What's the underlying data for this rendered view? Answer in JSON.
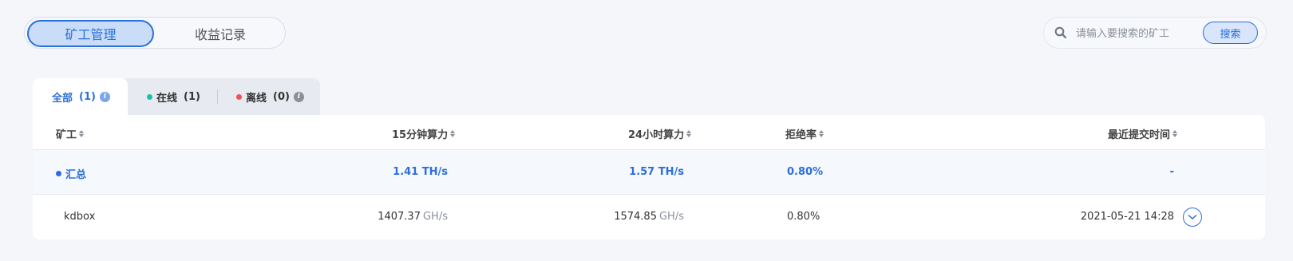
{
  "top_tabs": {
    "active": "矿工管理",
    "inactive": "收益记录"
  },
  "search": {
    "placeholder": "请输入要搜索的矿工",
    "button": "搜索"
  },
  "status_tabs": {
    "all": {
      "label": "全部",
      "count": "(1)"
    },
    "online": {
      "label": "在线",
      "count": "(1)",
      "dot_color": "#1dbfb0"
    },
    "offline": {
      "label": "离线",
      "count": "(0)",
      "dot_color": "#f0505b"
    }
  },
  "table": {
    "headers": [
      "矿工",
      "15分钟算力",
      "24小时算力",
      "拒绝率",
      "最近提交时间"
    ],
    "summary": {
      "name": "汇总",
      "h15": "1.41 TH/s",
      "h24": "1.57 TH/s",
      "reject": "0.80%",
      "last": "-",
      "dot_color": "#2c6fd8"
    },
    "rows": [
      {
        "name": "kdbox",
        "h15": "1407.37",
        "h15_unit": "GH/s",
        "h24": "1574.85",
        "h24_unit": "GH/s",
        "reject": "0.80%",
        "last": "2021-05-21 14:28"
      }
    ]
  },
  "colors": {
    "accent": "#2c6fd8"
  }
}
